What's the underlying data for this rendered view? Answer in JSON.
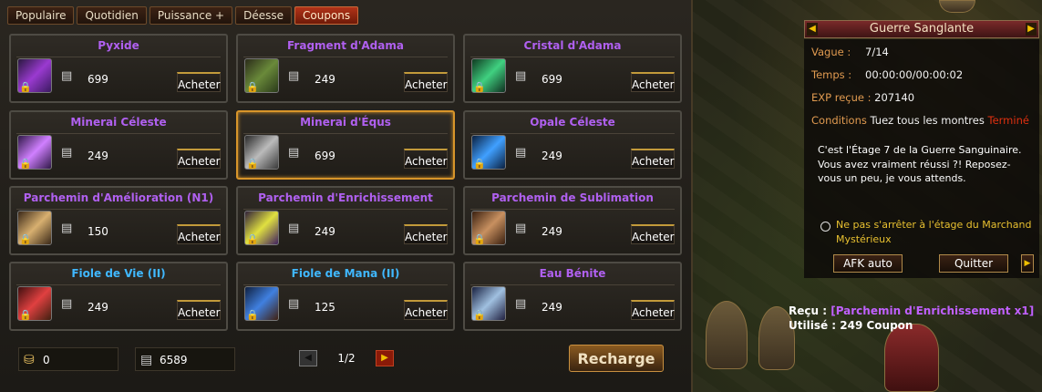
{
  "tabs": [
    "Populaire",
    "Quotidien",
    "Puissance +",
    "Déesse",
    "Coupons"
  ],
  "active_tab": "Coupons",
  "buy_label": "Acheter",
  "items": [
    {
      "name": "Pyxide",
      "price": "699",
      "color": "#b060f0"
    },
    {
      "name": "Fragment d'Adama",
      "price": "249",
      "color": "#b060f0"
    },
    {
      "name": "Cristal d'Adama",
      "price": "699",
      "color": "#b060f0"
    },
    {
      "name": "Minerai Céleste",
      "price": "249",
      "color": "#b060f0"
    },
    {
      "name": "Minerai d'Équs",
      "price": "699",
      "color": "#b060f0"
    },
    {
      "name": "Opale Céleste",
      "price": "249",
      "color": "#b060f0"
    },
    {
      "name": "Parchemin d'Amélioration (N1)",
      "price": "150",
      "color": "#b060f0"
    },
    {
      "name": "Parchemin d'Enrichissement",
      "price": "249",
      "color": "#b060f0"
    },
    {
      "name": "Parchemin de Sublimation",
      "price": "249",
      "color": "#b060f0"
    },
    {
      "name": "Fiole de Vie (II)",
      "price": "249",
      "color": "#40b8ff"
    },
    {
      "name": "Fiole de Mana (II)",
      "price": "125",
      "color": "#40b8ff"
    },
    {
      "name": "Eau Bénite",
      "price": "249",
      "color": "#b060f0"
    }
  ],
  "gold_amount": "0",
  "coupon_amount": "6589",
  "page": "1/2",
  "recharge_label": "Recharge",
  "war": {
    "title": "Guerre Sanglante",
    "wave_label": "Vague :",
    "wave_value": "7/14",
    "time_label": "Temps :",
    "time_value": "00:00:00/00:00:02",
    "exp_label": "EXP reçue :",
    "exp_value": "207140",
    "cond_label": "Conditions",
    "cond_value": "Tuez tous les montres",
    "cond_status": "Terminé",
    "message": "C'est l'Étage 7 de la Guerre Sanguinaire. Vous avez vraiment réussi ?! Reposez-vous un peu, je vous attends.",
    "checkbox_label": "Ne pas s'arrêter à l'étage du Marchand Mystérieux",
    "afk_label": "AFK auto",
    "quit_label": "Quitter"
  },
  "received": {
    "recu_label": "Reçu :",
    "recu_value": "[Parchemin d'Enrichissement x1]",
    "used_label": "Utilisé :",
    "used_value": "249 Coupon"
  }
}
